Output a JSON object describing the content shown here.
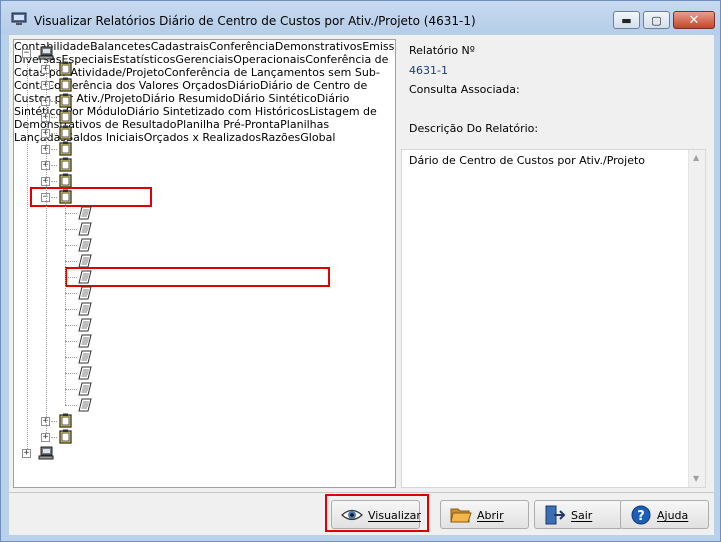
{
  "window": {
    "title": "Visualizar Relatórios Diário de Centro de Custos por Ativ./Projeto (4631-1)",
    "controls": {
      "minimize": "▬",
      "maximize": "▢",
      "close": "✕"
    }
  },
  "tree": {
    "root": "Contabilidade",
    "folders": [
      "Balancetes",
      "Cadastrais",
      "Conferência",
      "Demonstrativos",
      "Emissões Diversas",
      "Especiais",
      "Estatísticos",
      "Gerenciais",
      "Operacionais"
    ],
    "operacionais_items": [
      "Conferência de Cotas por Atividade/Projeto",
      "Conferência de Lançamentos sem Sub-Conta",
      "Conferência dos Valores Orçados",
      "Diário",
      "Diário de Centro de Custos por Ativ./Projeto",
      "Diário Resumido",
      "Diário Sintético",
      "Diário Sintético Por Módulo",
      "Diário Sintetizado com Históricos",
      "Listagem de Demonstrativos de Resultado",
      "Planilha Pré-Pronta",
      "Planilhas Lançadas",
      "Saldos Iniciais"
    ],
    "after_folders": [
      "Orçados x Realizados",
      "Razões"
    ],
    "second_root": "Global",
    "expander_plus": "+",
    "expander_minus": "−",
    "selected_item": "Diário de Centro de Custos por Ativ./Projeto"
  },
  "info": {
    "report_number_label": "Relatório Nº",
    "report_number_value": "4631-1",
    "associated_query_label": "Consulta Associada:",
    "description_label": "Descrição Do Relatório:",
    "description_text": "Dário de Centro de Custos por Ativ./Projeto"
  },
  "buttons": {
    "view": "Visualizar",
    "open": "Abrir",
    "exit": "Sair",
    "help": "Ajuda"
  },
  "colors": {
    "highlight": "#e00000",
    "value_text": "#1a3a8c",
    "folder": "#f4e04a"
  },
  "scrollbar": {
    "up": "▲",
    "down": "▼"
  }
}
